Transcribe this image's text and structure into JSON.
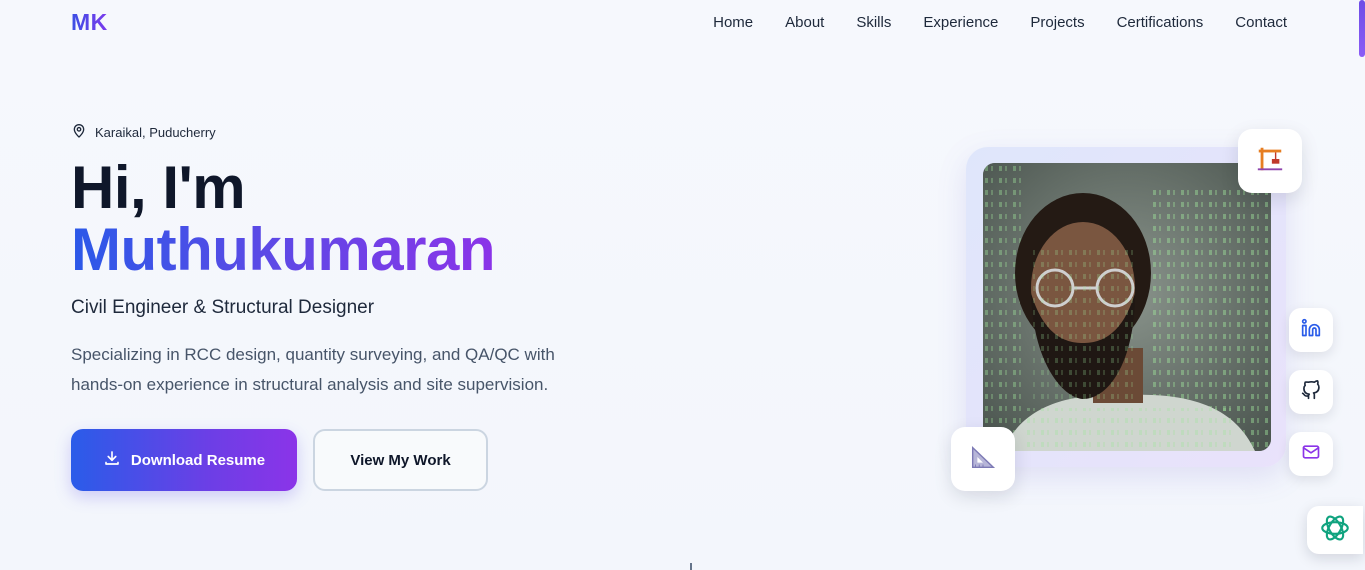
{
  "nav": {
    "logo": "MK",
    "items": [
      {
        "label": "Home"
      },
      {
        "label": "About"
      },
      {
        "label": "Skills"
      },
      {
        "label": "Experience"
      },
      {
        "label": "Projects"
      },
      {
        "label": "Certifications"
      },
      {
        "label": "Contact"
      }
    ]
  },
  "hero": {
    "location": "Karaikal, Puducherry",
    "greeting": "Hi, I'm",
    "name": "Muthukumaran",
    "role": "Civil Engineer & Structural Designer",
    "description": "Specializing in RCC design, quantity surveying, and QA/QC with hands-on experience in structural analysis and site supervision.",
    "primary_button": "Download Resume",
    "secondary_button": "View My Work"
  },
  "icons": {
    "location": "map-pin-icon",
    "download": "download-icon",
    "crane": "crane-icon",
    "ruler": "set-square-ruler-icon",
    "linkedin": "linkedin-icon",
    "github": "github-icon",
    "mail": "mail-icon",
    "chat": "chatgpt-icon"
  },
  "colors": {
    "accent_start": "#2a5ce9",
    "accent_end": "#8b34e8",
    "text_dark": "#0f172a",
    "text_muted": "#475569",
    "background": "#f4f6fc"
  }
}
